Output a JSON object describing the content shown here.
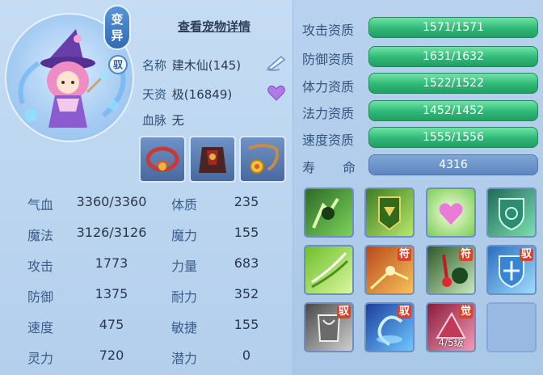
{
  "header": {
    "variant_badge": [
      "变",
      "异"
    ],
    "tamed_badge": "驭",
    "detail_link": "查看宠物详情"
  },
  "pet": {
    "name_label": "名称",
    "name_value": "建木仙(145)",
    "talent_label": "天资",
    "talent_value": "极(16849)",
    "bloodline_label": "血脉",
    "bloodline_value": "无"
  },
  "stats": [
    {
      "label": "气血",
      "value": "3360/3360"
    },
    {
      "label": "魔法",
      "value": "3126/3126"
    },
    {
      "label": "攻击",
      "value": "1773"
    },
    {
      "label": "防御",
      "value": "1375"
    },
    {
      "label": "速度",
      "value": "475"
    },
    {
      "label": "灵力",
      "value": "720"
    }
  ],
  "attributes": [
    {
      "label": "体质",
      "value": "235"
    },
    {
      "label": "魔力",
      "value": "155"
    },
    {
      "label": "力量",
      "value": "683"
    },
    {
      "label": "耐力",
      "value": "352"
    },
    {
      "label": "敏捷",
      "value": "155"
    },
    {
      "label": "潜力",
      "value": "0"
    }
  ],
  "aptitudes": [
    {
      "label": "攻击资质",
      "value": "1571/1571"
    },
    {
      "label": "防御资质",
      "value": "1631/1632"
    },
    {
      "label": "体力资质",
      "value": "1522/1522"
    },
    {
      "label": "法力资质",
      "value": "1452/1452"
    },
    {
      "label": "速度资质",
      "value": "1555/1556"
    }
  ],
  "lifespan": {
    "label_a": "寿",
    "label_b": "命",
    "value": "4316"
  },
  "skills": [
    {
      "icon": "green-warrior-skill-icon",
      "tag": ""
    },
    {
      "icon": "green-shield-banner-skill-icon",
      "tag": ""
    },
    {
      "icon": "heart-skill-icon",
      "tag": ""
    },
    {
      "icon": "green-shield-skill-icon",
      "tag": ""
    },
    {
      "icon": "green-wind-skill-icon",
      "tag": ""
    },
    {
      "icon": "fire-talisman-skill-icon",
      "tag": "符"
    },
    {
      "icon": "blood-talisman-skill-icon",
      "tag": "符"
    },
    {
      "icon": "blue-shield-skill-icon",
      "tag": "驭"
    },
    {
      "icon": "grey-armor-skill-icon",
      "tag": "驭"
    },
    {
      "icon": "blue-vortex-skill-icon",
      "tag": "驭"
    },
    {
      "icon": "awaken-skill-icon",
      "tag": "觉",
      "level": "4/5级"
    }
  ],
  "colors": {
    "aptitude_bar": "#2fb877",
    "life_bar": "#6b93c9",
    "tag_red": "#d8432b"
  }
}
